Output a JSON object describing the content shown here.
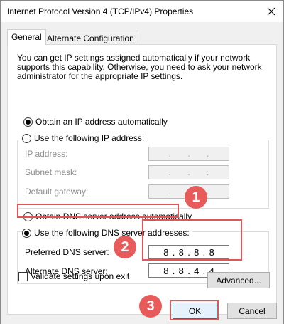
{
  "window": {
    "title": "Internet Protocol Version 4 (TCP/IPv4) Properties"
  },
  "tabs": [
    {
      "label": "General"
    },
    {
      "label": "Alternate Configuration"
    }
  ],
  "general": {
    "intro": "You can get IP settings assigned automatically if your network supports this capability. Otherwise, you need to ask your network administrator for the appropriate IP settings.",
    "ip_auto_label": "Obtain an IP address automatically",
    "ip_manual_label": "Use the following IP address:",
    "ip_address_label": "IP address:",
    "subnet_label": "Subnet mask:",
    "gateway_label": "Default gateway:",
    "dns_auto_label": "Obtain DNS server address automatically",
    "dns_manual_label": "Use the following DNS server addresses:",
    "preferred_dns_label": "Preferred DNS server:",
    "alternate_dns_label": "Alternate DNS server:",
    "preferred_dns": [
      "8",
      "8",
      "8",
      "8"
    ],
    "alternate_dns": [
      "8",
      "8",
      "4",
      "4"
    ],
    "empty_dots": [
      ".",
      ".",
      "."
    ],
    "validate_label": "Validate settings upon exit",
    "advanced_label": "Advanced..."
  },
  "footer": {
    "ok_label": "OK",
    "cancel_label": "Cancel"
  },
  "annotations": {
    "step1": "1",
    "step2": "2",
    "step3": "3",
    "highlight_color": "#e05555"
  }
}
